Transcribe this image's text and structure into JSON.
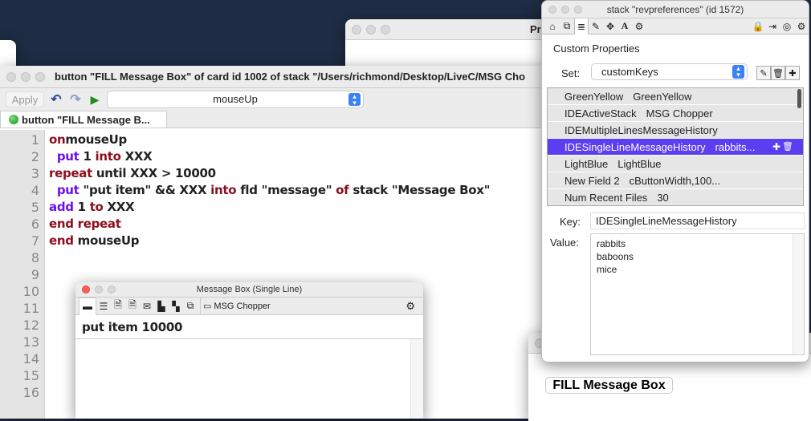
{
  "script_editor": {
    "title": "button \"FILL Message Box\" of card id 1002 of stack \"/Users/richmond/Desktop/LiveC/MSG Cho",
    "apply_label": "Apply",
    "handler_select": "mouseUp",
    "tab_label": "button \"FILL Message B...",
    "line_numbers": [
      "1",
      "2",
      "3",
      "4",
      "5",
      "6",
      "7",
      "8",
      "9",
      "10",
      "11",
      "12",
      "13",
      "14",
      "15",
      "16"
    ],
    "code": [
      [
        [
          "kw",
          "on"
        ],
        [
          "",
          "mouseUp"
        ]
      ],
      [
        [
          "",
          "  "
        ],
        [
          "cmd",
          "put"
        ],
        [
          "",
          " 1 "
        ],
        [
          "kw",
          "into"
        ],
        [
          "",
          " XXX"
        ]
      ],
      [
        [
          "kw",
          "repeat"
        ],
        [
          "",
          " until XXX > 10000"
        ]
      ],
      [
        [
          "",
          "  "
        ],
        [
          "cmd",
          "put"
        ],
        [
          "",
          " \"put item\" && XXX "
        ],
        [
          "kw",
          "into"
        ],
        [
          "",
          " fld \"message\" "
        ],
        [
          "kw",
          "of"
        ],
        [
          "",
          " stack \"Message Box\""
        ]
      ],
      [
        [
          "cmd",
          "add"
        ],
        [
          "",
          " 1 "
        ],
        [
          "kw",
          "to"
        ],
        [
          "",
          " XXX"
        ]
      ],
      [
        [
          "kw",
          "end repeat"
        ]
      ],
      [
        [
          "kw",
          "end"
        ],
        [
          "",
          " mouseUp"
        ]
      ]
    ]
  },
  "back_window": {
    "title": "Pr"
  },
  "message_box": {
    "title": "Message Box (Single Line)",
    "stack_label": "MSG Chopper",
    "message": "put item 10000"
  },
  "card_window": {
    "button_label": "FILL Message Box"
  },
  "inspector": {
    "title": "stack \"revpreferences\" (id 1572)",
    "section_title": "Custom Properties",
    "set_label": "Set:",
    "set_value": "customKeys",
    "rows": [
      {
        "key": "GreenYellow",
        "value": "GreenYellow"
      },
      {
        "key": "IDEActiveStack",
        "value": "MSG Chopper"
      },
      {
        "key": "IDEMultipleLinesMessageHistory",
        "value": ""
      },
      {
        "key": "IDESingleLineMessageHistory",
        "value": "rabbits..."
      },
      {
        "key": "LightBlue",
        "value": "LightBlue"
      },
      {
        "key": "New Field 2",
        "value": "cButtonWidth,100..."
      },
      {
        "key": "Num Recent Files",
        "value": "30"
      }
    ],
    "selected_row": 3,
    "key_label": "Key:",
    "key_value": "IDESingleLineMessageHistory",
    "value_label": "Value:",
    "value_lines": [
      "rabbits",
      "baboons",
      "mice"
    ]
  }
}
